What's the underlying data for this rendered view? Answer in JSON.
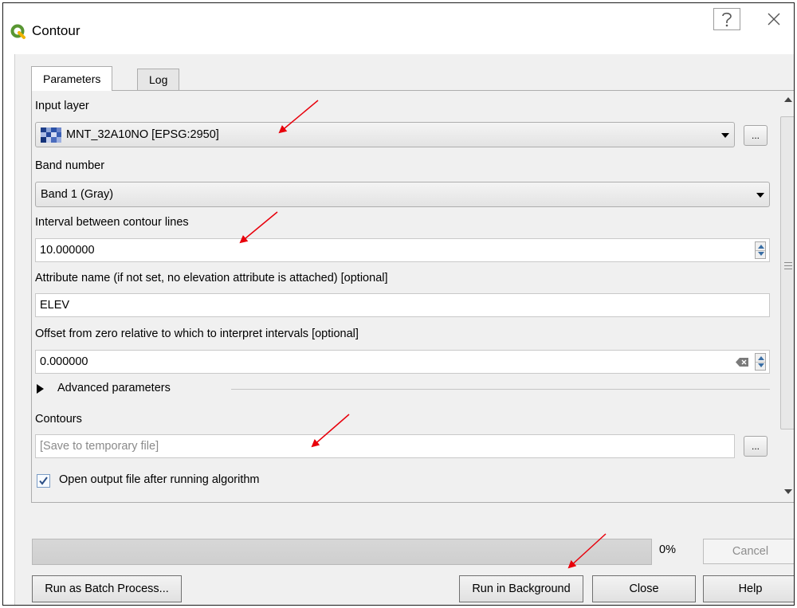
{
  "window": {
    "title": "Contour",
    "help_glyph": "?",
    "close_glyph": "X"
  },
  "tabs": [
    {
      "label": "Parameters",
      "active": true
    },
    {
      "label": "Log",
      "active": false
    }
  ],
  "params": {
    "input_layer_label": "Input layer",
    "input_layer_value": "MNT_32A10NO [EPSG:2950]",
    "browse_glyph": "...",
    "band_label": "Band number",
    "band_value": "Band 1 (Gray)",
    "interval_label": "Interval between contour lines",
    "interval_value": "10.000000",
    "attribute_label": "Attribute name (if not set, no elevation attribute is attached) [optional]",
    "attribute_value": "ELEV",
    "offset_label": "Offset from zero relative to which to interpret intervals [optional]",
    "offset_value": "0.000000",
    "advanced_label": "Advanced parameters",
    "contours_label": "Contours",
    "contours_placeholder": "[Save to temporary file]",
    "open_output_label": "Open output file after running algorithm",
    "open_output_checked": true
  },
  "progress": {
    "percent": 0,
    "percent_text": "0%"
  },
  "buttons": {
    "cancel": "Cancel",
    "batch": "Run as Batch Process...",
    "run_background": "Run in Background",
    "close": "Close",
    "help": "Help"
  },
  "colors": {
    "qgis_green": "#589632",
    "annotation_red": "#e8000b",
    "checkbox_blue": "#3a6ea5"
  }
}
